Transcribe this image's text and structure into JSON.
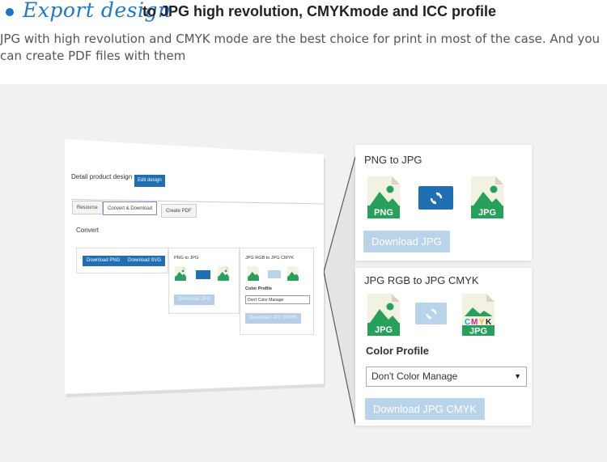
{
  "header": {
    "script_title": "Export design",
    "main_title": "to JPG high revolution, CMYKmode and ICC profile",
    "description": "JPG with high revolution and CMYK mode are the best choice for print in most of the case. And you can create PDF files with them"
  },
  "mini": {
    "title": "Detail product design",
    "edit_button": "Edit design",
    "tabs": [
      "Resource",
      "Convert & Download",
      "Create PDF"
    ],
    "convert_label": "Convert",
    "download_png": "Download PNG",
    "download_svg": "Download SVG",
    "png_to_jpg": "PNG to JPG",
    "download_jpg": "Download JPG",
    "rgb_to_cmyk": "JPG RGB to JPG CMYK",
    "color_profile": "Color Profile",
    "select_value": "Don't Color Manage",
    "download_jpg_cmyk": "Download JPG CMYK"
  },
  "panel_png_to_jpg": {
    "title": "PNG to JPG",
    "source_label": "PNG",
    "target_label": "JPG",
    "download_button": "Download JPG"
  },
  "panel_rgb_to_cmyk": {
    "title": "JPG RGB to JPG CMYK",
    "source_label": "JPG",
    "target_label": "JPG",
    "target_badge": [
      "C",
      "M",
      "Y",
      "K"
    ],
    "color_profile_label": "Color Profile",
    "select_value": "Don't Color Manage",
    "download_button": "Download JPG CMYK"
  },
  "colors": {
    "accent_blue": "#1f77c9",
    "button_blue": "#1f6fb2",
    "disabled_button": "#b8d3ea",
    "file_green": "#27a05c",
    "file_paper": "#f3f1e2",
    "cmyk_cyan": "#1ba3d8",
    "cmyk_magenta": "#d6257a",
    "cmyk_yellow": "#f2b705",
    "cmyk_black": "#222222"
  },
  "icons": [
    "bullet-dot-icon",
    "png-file-icon",
    "jpg-file-icon",
    "convert-sync-icon",
    "cmyk-jpg-file-icon",
    "chevron-down-icon"
  ]
}
